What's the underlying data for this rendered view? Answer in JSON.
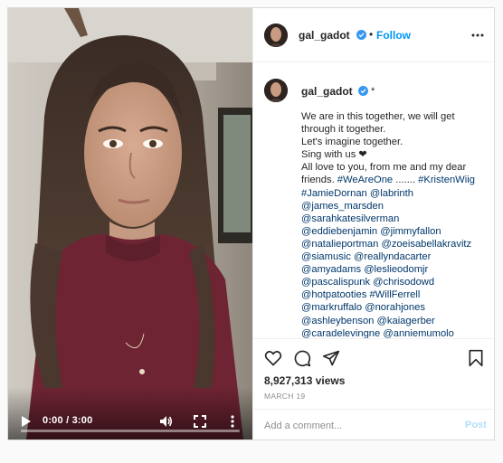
{
  "post": {
    "username": "gal_gadot",
    "follow_separator": "•",
    "follow_label": "Follow",
    "caption_marker": "*",
    "caption_lines": [
      [
        {
          "t": "We are in this together, we will get"
        }
      ],
      [
        {
          "t": "through it together."
        }
      ],
      [
        {
          "t": "Let's imagine together."
        }
      ],
      [
        {
          "t": "Sing with us ❤"
        }
      ],
      [
        {
          "t": "All love to you, from me and my dear"
        }
      ],
      [
        {
          "t": "friends. "
        },
        {
          "t": "#WeAreOne",
          "tag": true
        },
        {
          "t": " ....... "
        },
        {
          "t": "#KristenWiig",
          "tag": true
        }
      ],
      [
        {
          "t": "#JamieDornan",
          "tag": true
        },
        {
          "t": " "
        },
        {
          "t": "@labrinth",
          "tag": true
        }
      ],
      [
        {
          "t": "@james_marsden",
          "tag": true
        }
      ],
      [
        {
          "t": "@sarahkatesilverman",
          "tag": true
        }
      ],
      [
        {
          "t": "@eddiebenjamin",
          "tag": true
        },
        {
          "t": " "
        },
        {
          "t": "@jimmyfallon",
          "tag": true
        }
      ],
      [
        {
          "t": "@natalieportman",
          "tag": true
        },
        {
          "t": " "
        },
        {
          "t": "@zoeisabellakravitz",
          "tag": true
        }
      ],
      [
        {
          "t": "@siamusic",
          "tag": true
        },
        {
          "t": " "
        },
        {
          "t": "@reallyndacarter",
          "tag": true
        }
      ],
      [
        {
          "t": "@amyadams",
          "tag": true
        },
        {
          "t": " "
        },
        {
          "t": "@leslieodomjr",
          "tag": true
        }
      ],
      [
        {
          "t": "@pascalispunk",
          "tag": true
        },
        {
          "t": " "
        },
        {
          "t": "@chrisodowd",
          "tag": true
        }
      ],
      [
        {
          "t": "@hotpatooties",
          "tag": true
        },
        {
          "t": " "
        },
        {
          "t": "#WillFerrell",
          "tag": true
        }
      ],
      [
        {
          "t": "@markruffalo",
          "tag": true
        },
        {
          "t": " "
        },
        {
          "t": "@norahjones",
          "tag": true
        }
      ],
      [
        {
          "t": "@ashleybenson",
          "tag": true
        },
        {
          "t": " "
        },
        {
          "t": "@kaiagerber",
          "tag": true
        }
      ],
      [
        {
          "t": "@caradelevingne",
          "tag": true
        },
        {
          "t": " "
        },
        {
          "t": "@anniemumolo",
          "tag": true
        }
      ]
    ],
    "views": "8,927,313 views",
    "date": "MARCH 19",
    "comment_placeholder": "Add a comment...",
    "post_label": "Post"
  },
  "video": {
    "time": "0:00 / 3:00",
    "progress": 0
  },
  "icons": {
    "verified": "verified-badge-icon",
    "more": "more-options-icon",
    "like": "heart-icon",
    "comment": "comment-icon",
    "share": "paper-plane-icon",
    "save": "bookmark-icon",
    "play": "play-icon",
    "volume": "volume-icon",
    "fullscreen": "fullscreen-icon",
    "video_more": "vertical-more-icon"
  },
  "colors": {
    "link": "#0095f6",
    "tag": "#00376b",
    "verified": "#3897f0",
    "post_disabled": "#b2dffc"
  }
}
